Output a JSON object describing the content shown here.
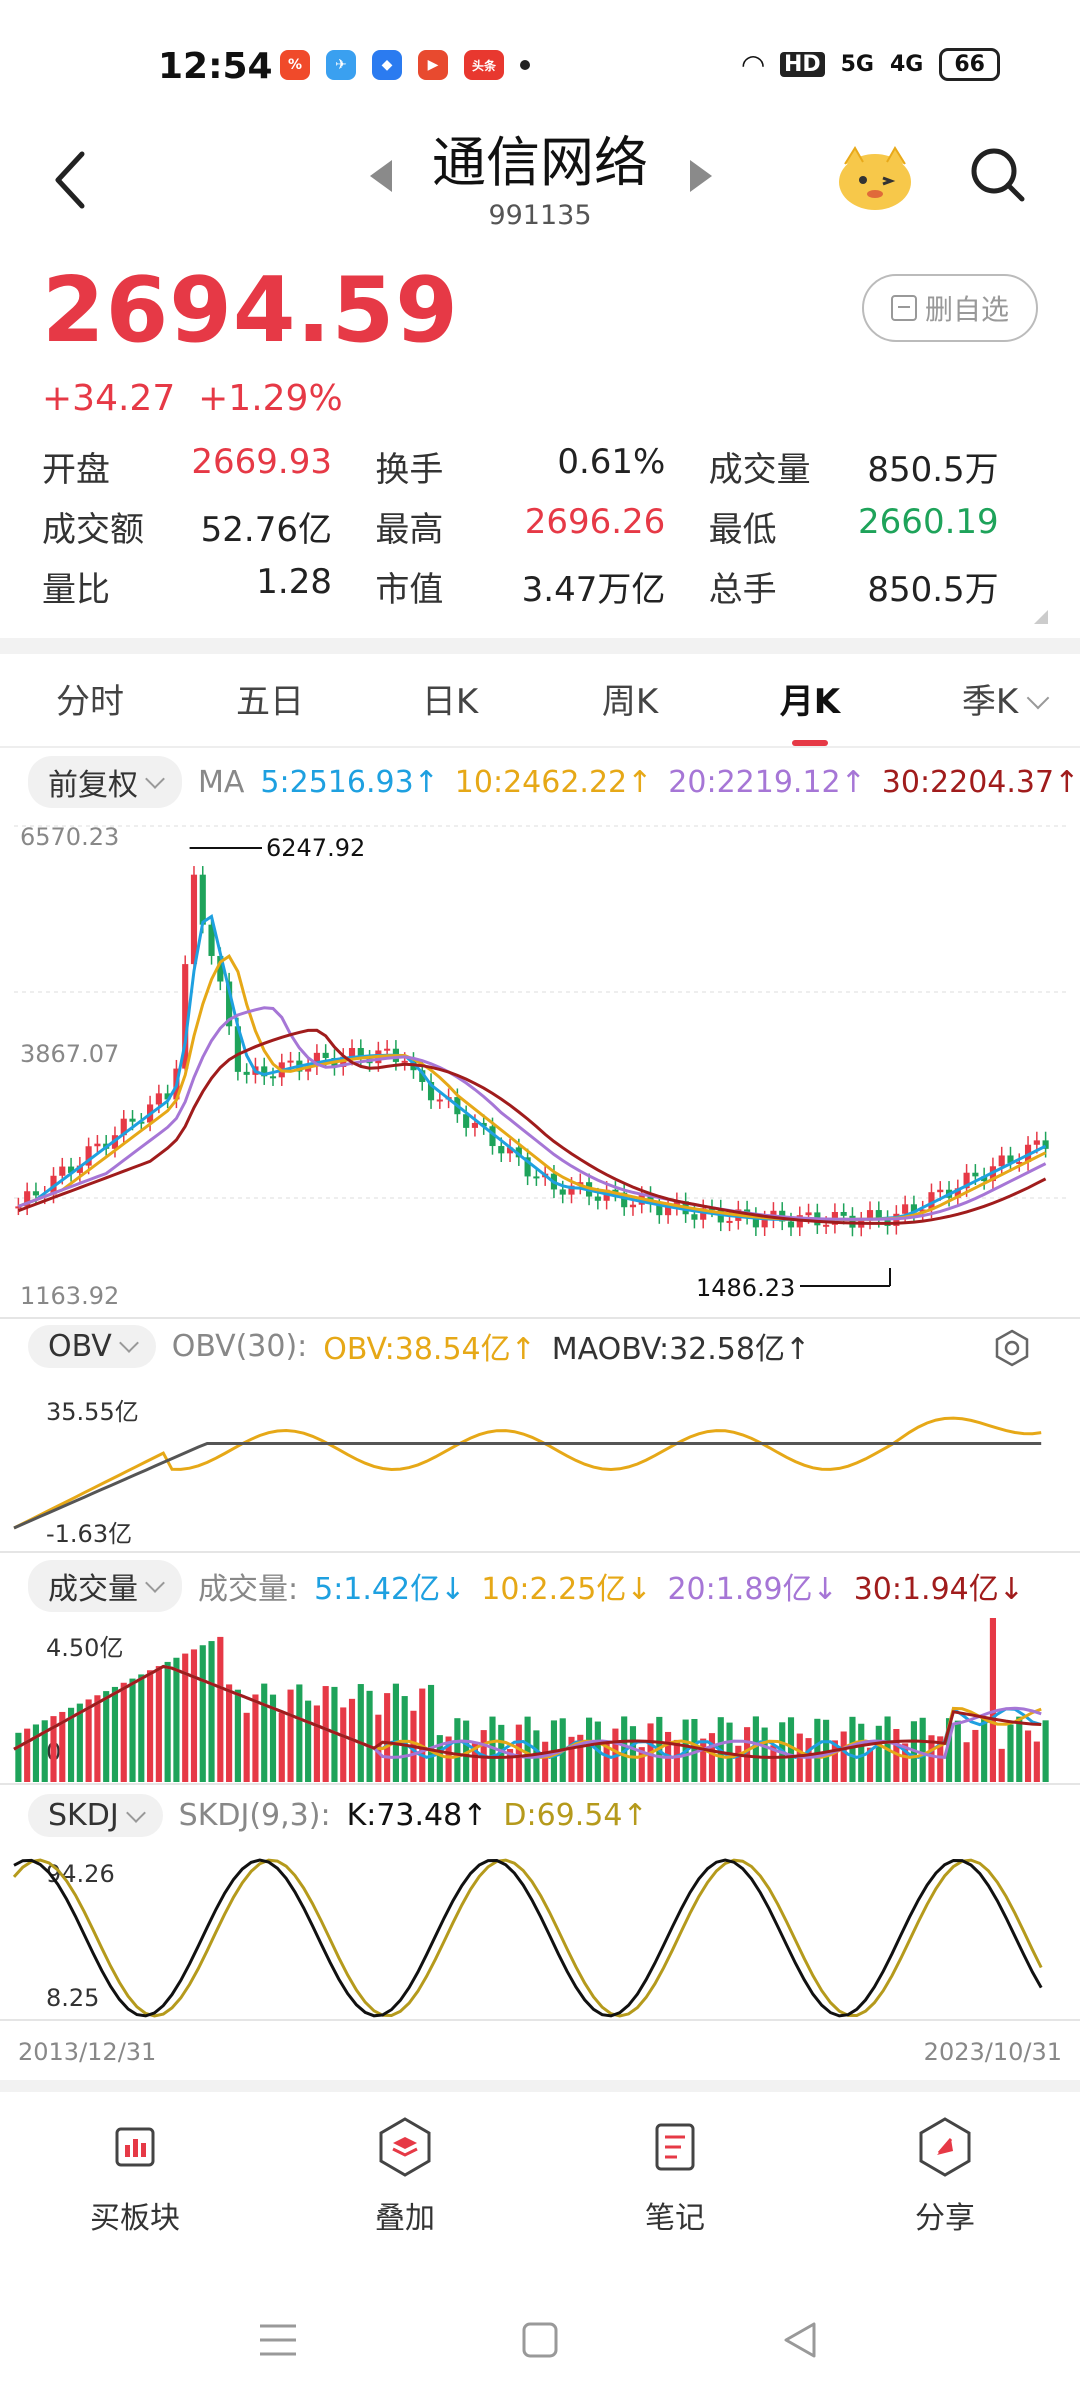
{
  "status": {
    "time": "12:54",
    "battery": "66",
    "net1": "HD",
    "net2": "5G",
    "net3": "4G"
  },
  "header": {
    "title": "通信网络",
    "code": "991135"
  },
  "quote": {
    "price": "2694.59",
    "change": "+34.27",
    "change_pct": "+1.29%",
    "remove_watch": "删自选",
    "rows": [
      [
        {
          "k": "开盘",
          "v": "2669.93",
          "c": "red"
        },
        {
          "k": "换手",
          "v": "0.61%",
          "c": ""
        },
        {
          "k": "成交量",
          "v": "850.5万",
          "c": ""
        }
      ],
      [
        {
          "k": "成交额",
          "v": "52.76亿",
          "c": ""
        },
        {
          "k": "最高",
          "v": "2696.26",
          "c": "red"
        },
        {
          "k": "最低",
          "v": "2660.19",
          "c": "green"
        }
      ],
      [
        {
          "k": "量比",
          "v": "1.28",
          "c": ""
        },
        {
          "k": "市值",
          "v": "3.47万亿",
          "c": ""
        },
        {
          "k": "总手",
          "v": "850.5万",
          "c": ""
        }
      ]
    ]
  },
  "tabs": [
    "分时",
    "五日",
    "日K",
    "周K",
    "月K",
    "季K"
  ],
  "active_tab": "月K",
  "kline": {
    "adjust": "前复权",
    "ma_label": "MA",
    "ma5": "5:2516.93↑",
    "ma10": "10:2462.22↑",
    "ma20": "20:2219.12↑",
    "ma30": "30:2204.37↑",
    "y_top": "6570.23",
    "y_mid": "3867.07",
    "y_bot": "1163.92",
    "high_mark": "6247.92",
    "low_mark": "1486.23"
  },
  "obv": {
    "name": "OBV",
    "param": "OBV(30):",
    "obv": "OBV:38.54亿↑",
    "maobv": "MAOBV:32.58亿↑",
    "y_top": "35.55亿",
    "y_bot": "-1.63亿"
  },
  "vol": {
    "name": "成交量",
    "param": "成交量:",
    "v5": "5:1.42亿↓",
    "v10": "10:2.25亿↓",
    "v20": "20:1.89亿↓",
    "v30": "30:1.94亿↓",
    "y_top": "4.50亿",
    "y_bot": "0"
  },
  "skdj": {
    "name": "SKDJ",
    "param": "SKDJ(9,3):",
    "k": "K:73.48↑",
    "d": "D:69.54↑",
    "y_top": "94.26",
    "y_bot": "8.25"
  },
  "dates": {
    "start": "2013/12/31",
    "end": "2023/10/31"
  },
  "bottom_nav": [
    {
      "label": "买板块",
      "icon": "sector-icon"
    },
    {
      "label": "叠加",
      "icon": "overlay-icon"
    },
    {
      "label": "笔记",
      "icon": "note-icon"
    },
    {
      "label": "分享",
      "icon": "share-icon"
    }
  ],
  "colors": {
    "up": "#e63946",
    "down": "#1ea35a",
    "ma5": "#1ea0e0",
    "ma10": "#e6a817",
    "ma20": "#a676d6",
    "ma30": "#a01c1c"
  }
}
